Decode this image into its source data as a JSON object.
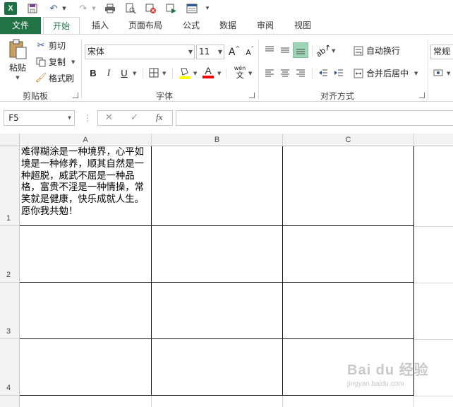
{
  "tabs": [
    "文件",
    "开始",
    "插入",
    "页面布局",
    "公式",
    "数据",
    "审阅",
    "视图"
  ],
  "clipboard": {
    "paste": "粘贴",
    "cut": "剪切",
    "copy": "复制",
    "format_painter": "格式刷",
    "group_label": "剪贴板"
  },
  "font": {
    "name": "宋体",
    "size": "11",
    "bold": "B",
    "italic": "I",
    "underline": "U",
    "grow": "A",
    "shrink": "A",
    "font_color": "A",
    "phonetic_top": "wén",
    "phonetic_bottom": "文",
    "group_label": "字体"
  },
  "alignment": {
    "wrap_text": "自动换行",
    "merge_center": "合并后居中",
    "group_label": "对齐方式"
  },
  "number": {
    "format": "常规"
  },
  "formula_bar": {
    "name_box": "F5",
    "fx": "fx",
    "cancel": "✕",
    "enter": "✓"
  },
  "columns": [
    "A",
    "B",
    "C"
  ],
  "rows": [
    "1",
    "2",
    "3",
    "4"
  ],
  "cells": {
    "A1": "难得糊涂是一种境界，心平如境是一种修养，顺其自然是一种超脱，威武不屈是一种品格，富贵不淫是一种情操，常笑就是健康，快乐成就人生。愿你我共勉！"
  },
  "watermark": {
    "brand": "Bai du 经验",
    "url": "jingyan.baidu.com"
  },
  "colors": {
    "excel_green": "#217346",
    "fill_yellow": "#ffff00",
    "font_red": "#ff0000",
    "selected_align": "#9fd5b7"
  }
}
